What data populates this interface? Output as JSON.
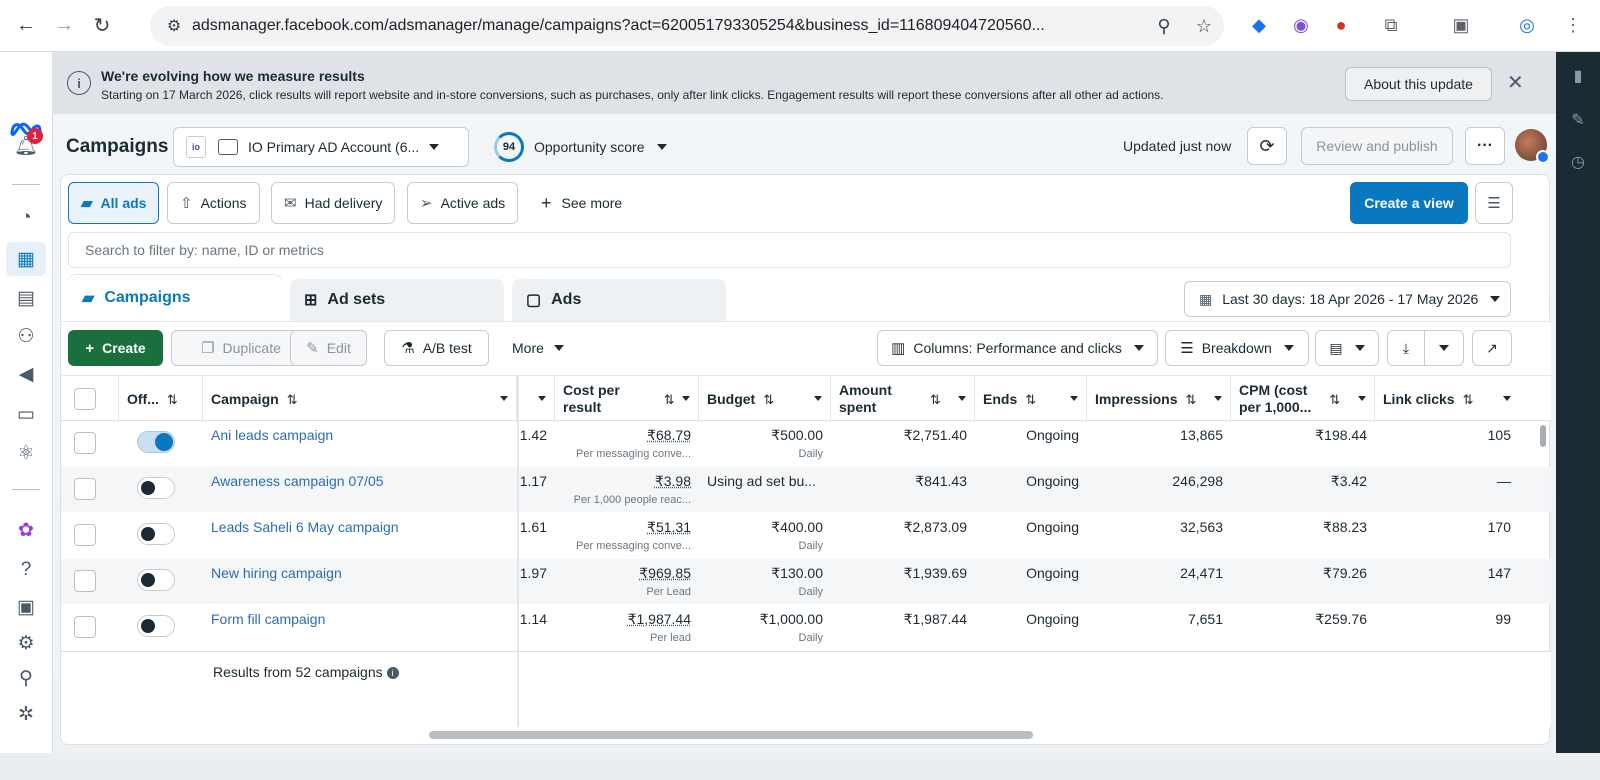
{
  "browser": {
    "url": "adsmanager.facebook.com/adsmanager/manage/campaigns?act=620051793305254&business_id=116809404720560...",
    "back_icon": "back-arrow-icon",
    "forward_icon": "forward-arrow-icon",
    "reload_icon": "reload-icon"
  },
  "rail": {
    "notifications_badge": "1",
    "items": [
      "notifications-icon",
      "dashboard-icon",
      "campaigns-table-icon",
      "reports-icon",
      "audiences-icon",
      "ads-icon",
      "billing-icon",
      "business-icon",
      "apps-icon",
      "help-icon",
      "pages-icon",
      "settings-icon",
      "search-icon",
      "bug-icon"
    ]
  },
  "banner": {
    "title": "We're evolving how we measure results",
    "text": "Starting on 17 March 2026, click results will report website and in-store conversions, such as purchases, only after link clicks. Engagement results will report these conversions after all other ad actions.",
    "about_label": "About this update"
  },
  "header": {
    "title": "Campaigns",
    "account_logo_text": "io",
    "account_name": "IO Primary AD Account (6...",
    "opportunity_score": "94",
    "opportunity_label": "Opportunity score",
    "updated_text": "Updated just now",
    "review_label": "Review and publish",
    "more_label": "···"
  },
  "views": {
    "all_ads": "All ads",
    "actions": "Actions",
    "had_delivery": "Had delivery",
    "active_ads": "Active ads",
    "see_more": "See more",
    "create_view": "Create a view"
  },
  "search": {
    "placeholder": "Search to filter by: name, ID or metrics"
  },
  "tabs": {
    "campaigns": "Campaigns",
    "ad_sets": "Ad sets",
    "ads": "Ads"
  },
  "date_range": "Last 30 days: 18 Apr 2026 - 17 May 2026",
  "toolbar": {
    "create": "Create",
    "duplicate": "Duplicate",
    "edit": "Edit",
    "ab_test": "A/B test",
    "more": "More",
    "columns": "Columns: Performance and clicks",
    "breakdown": "Breakdown"
  },
  "table": {
    "headers": {
      "off": "Off...",
      "campaign": "Campaign",
      "cost_per_result_1": "Cost per",
      "cost_per_result_2": "result",
      "budget": "Budget",
      "amount_spent_1": "Amount",
      "amount_spent_2": "spent",
      "ends": "Ends",
      "impressions": "Impressions",
      "cpm_1": "CPM (cost",
      "cpm_2": "per 1,000...",
      "link_clicks": "Link clicks"
    },
    "rows": [
      {
        "on": true,
        "name": "Ani leads campaign",
        "partial": "1.42",
        "cpr": "₹68.79",
        "cpr_sub": "Per messaging conve...",
        "budget": "₹500.00",
        "budget_sub": "Daily",
        "spent": "₹2,751.40",
        "ends": "Ongoing",
        "impressions": "13,865",
        "cpm": "₹198.44",
        "clicks": "105"
      },
      {
        "on": false,
        "name": "Awareness campaign 07/05",
        "partial": "1.17",
        "cpr": "₹3.98",
        "cpr_sub": "Per 1,000 people reac...",
        "budget": "Using ad set bu...",
        "budget_sub": "",
        "spent": "₹841.43",
        "ends": "Ongoing",
        "impressions": "246,298",
        "cpm": "₹3.42",
        "clicks": "—"
      },
      {
        "on": false,
        "name": "Leads Saheli 6 May campaign",
        "partial": "1.61",
        "cpr": "₹51.31",
        "cpr_sub": "Per messaging conve...",
        "budget": "₹400.00",
        "budget_sub": "Daily",
        "spent": "₹2,873.09",
        "ends": "Ongoing",
        "impressions": "32,563",
        "cpm": "₹88.23",
        "clicks": "170"
      },
      {
        "on": false,
        "name": "New hiring campaign",
        "partial": "1.97",
        "cpr": "₹969.85",
        "cpr_sub": "Per Lead",
        "budget": "₹130.00",
        "budget_sub": "Daily",
        "spent": "₹1,939.69",
        "ends": "Ongoing",
        "impressions": "24,471",
        "cpm": "₹79.26",
        "clicks": "147"
      },
      {
        "on": false,
        "name": "Form fill campaign",
        "partial": "1.14",
        "cpr": "₹1,987.44",
        "cpr_sub": "Per lead",
        "budget": "₹1,000.00",
        "budget_sub": "Daily",
        "spent": "₹1,987.44",
        "ends": "Ongoing",
        "impressions": "7,651",
        "cpm": "₹259.76",
        "clicks": "99"
      }
    ],
    "summary": "Results from 52 campaigns"
  },
  "colors": {
    "accent": "#0a78be",
    "create_green": "#1b6f3f",
    "link": "#2d6cb4",
    "right_rail": "#1c2b33"
  }
}
